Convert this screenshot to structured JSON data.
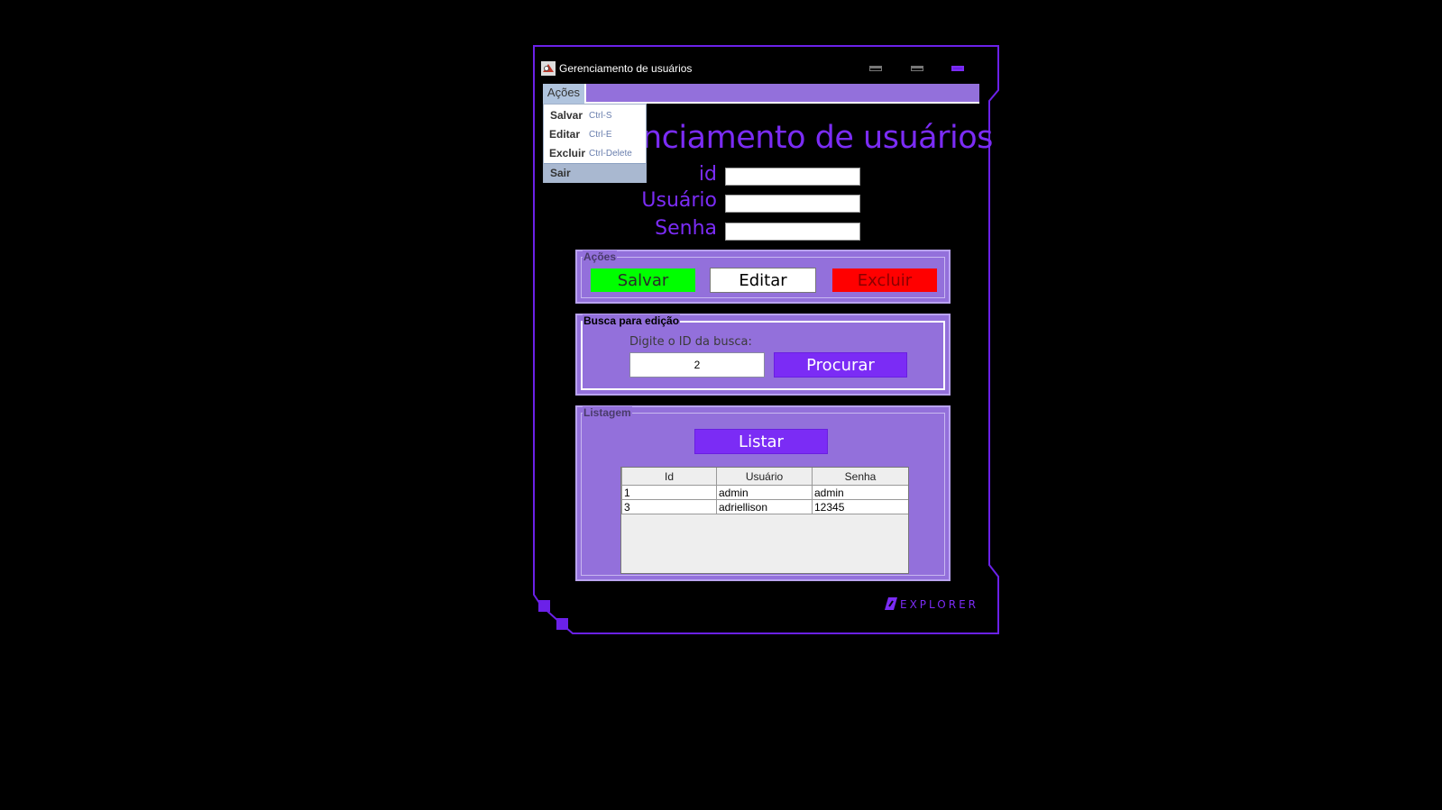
{
  "window": {
    "title": "Gerenciamento de usuários",
    "accent_color": "#7b2cf5",
    "panel_color": "#9370db"
  },
  "menubar": {
    "menu_label": "Ações",
    "dropdown": [
      {
        "label": "Salvar",
        "shortcut": "Ctrl-S"
      },
      {
        "label": "Editar",
        "shortcut": "Ctrl-E"
      },
      {
        "label": "Excluir",
        "shortcut": "Ctrl-Delete"
      },
      {
        "label": "Sair",
        "shortcut": ""
      }
    ]
  },
  "main": {
    "heading": "nciamento de usuários",
    "fields": {
      "id_label": "id",
      "usuario_label": "Usuário",
      "senha_label": "Senha",
      "id_value": "",
      "usuario_value": "",
      "senha_value": ""
    }
  },
  "acoes_panel": {
    "legend": "Ações",
    "salvar": "Salvar",
    "editar": "Editar",
    "excluir": "Excluir"
  },
  "busca_panel": {
    "legend": "Busca para edição",
    "prompt": "Digite o ID da busca:",
    "search_value": "2",
    "procurar": "Procurar"
  },
  "listagem_panel": {
    "legend": "Listagem",
    "listar": "Listar",
    "columns": [
      "Id",
      "Usuário",
      "Senha"
    ],
    "rows": [
      [
        "1",
        "admin",
        "admin"
      ],
      [
        "3",
        "adriellison",
        "12345"
      ]
    ]
  },
  "brand": {
    "text": "EXPLORER",
    "icon": "explorer-logo-icon"
  }
}
